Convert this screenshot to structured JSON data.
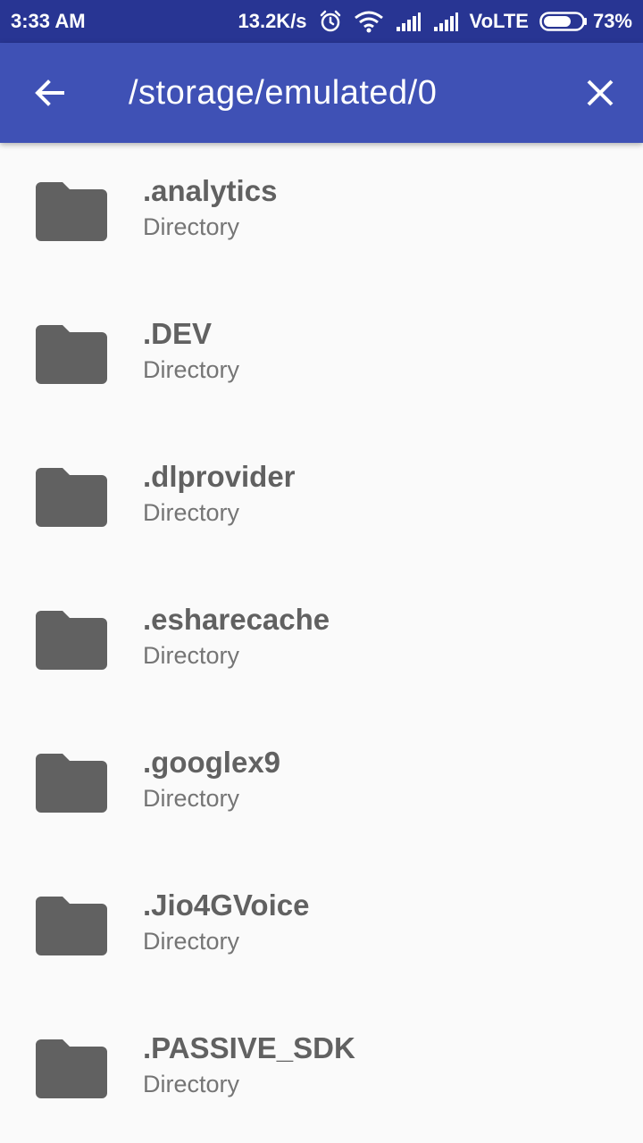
{
  "status_bar": {
    "time": "3:33 AM",
    "network_speed": "13.2K/s",
    "network_type": "VoLTE",
    "battery": "73%",
    "battery_level": 0.73,
    "icons": [
      "alarm-icon",
      "wifi-icon",
      "signal-icon",
      "signal-icon-2",
      "battery-icon"
    ]
  },
  "app_bar": {
    "title": "/storage/emulated/0",
    "back_icon": "arrow-back-icon",
    "close_icon": "close-icon"
  },
  "colors": {
    "status_bar": "#283593",
    "app_bar": "#3f51b5",
    "background": "#fafafa",
    "folder_icon": "#616161"
  },
  "files": [
    {
      "name": ".analytics",
      "type": "Directory"
    },
    {
      "name": ".DEV",
      "type": "Directory"
    },
    {
      "name": ".dlprovider",
      "type": "Directory"
    },
    {
      "name": ".esharecache",
      "type": "Directory"
    },
    {
      "name": ".googlex9",
      "type": "Directory"
    },
    {
      "name": ".Jio4GVoice",
      "type": "Directory"
    },
    {
      "name": ".PASSIVE_SDK",
      "type": "Directory"
    }
  ]
}
